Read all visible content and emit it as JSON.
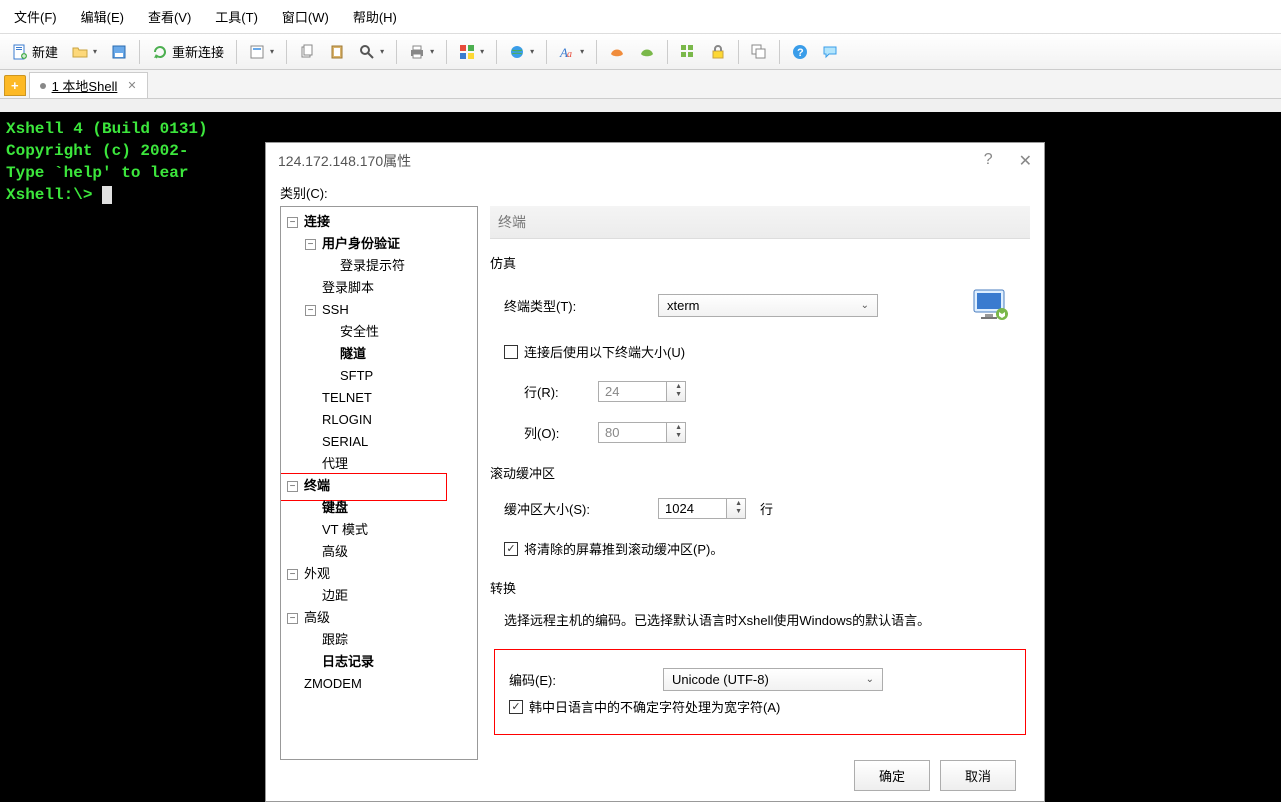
{
  "menubar": [
    "文件(F)",
    "编辑(E)",
    "查看(V)",
    "工具(T)",
    "窗口(W)",
    "帮助(H)"
  ],
  "toolbar": {
    "new_label": "新建",
    "reconnect_label": "重新连接"
  },
  "tab": {
    "label": "1 本地Shell"
  },
  "terminal": {
    "l1": "Xshell 4 (Build 0131)",
    "l2": "Copyright (c) 2002-",
    "l3": "",
    "l4": "Type `help' to lear",
    "l5": "Xshell:\\> "
  },
  "dialog": {
    "title": "124.172.148.170属性",
    "help": "?",
    "close": "✕",
    "category_label": "类别(C):",
    "tree": {
      "connection": "连接",
      "auth": "用户身份验证",
      "login_prompt": "登录提示符",
      "login_script": "登录脚本",
      "ssh": "SSH",
      "security": "安全性",
      "tunnel": "隧道",
      "sftp": "SFTP",
      "telnet": "TELNET",
      "rlogin": "RLOGIN",
      "serial": "SERIAL",
      "proxy": "代理",
      "terminal": "终端",
      "keyboard": "键盘",
      "vt_mode": "VT 模式",
      "advanced_term": "高级",
      "appearance": "外观",
      "margin": "边距",
      "advanced": "高级",
      "trace": "跟踪",
      "logging": "日志记录",
      "zmodem": "ZMODEM"
    },
    "panel": {
      "header": "终端",
      "sim_title": "仿真",
      "term_type_label": "终端类型(T):",
      "term_type_value": "xterm",
      "use_size_label": "连接后使用以下终端大小(U)",
      "rows_label": "行(R):",
      "rows_value": "24",
      "cols_label": "列(O):",
      "cols_value": "80",
      "scroll_title": "滚动缓冲区",
      "buffer_label": "缓冲区大小(S):",
      "buffer_value": "1024",
      "buffer_unit": "行",
      "push_cleared_label": "将清除的屏幕推到滚动缓冲区(P)。",
      "convert_title": "转换",
      "convert_desc": "选择远程主机的编码。已选择默认语言时Xshell使用Windows的默认语言。",
      "encoding_label": "编码(E):",
      "encoding_value": "Unicode (UTF-8)",
      "cjk_label": "韩中日语言中的不确定字符处理为宽字符(A)"
    },
    "buttons": {
      "ok": "确定",
      "cancel": "取消"
    }
  }
}
